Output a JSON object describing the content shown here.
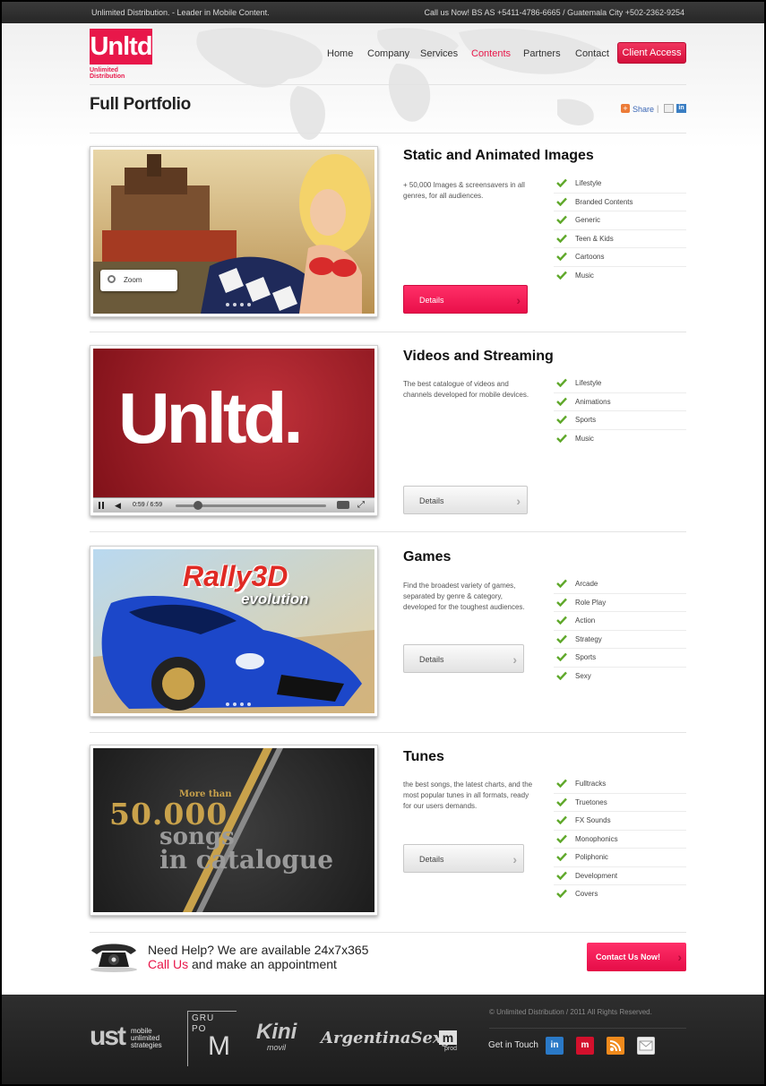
{
  "topbar": {
    "left_text": "Unlimited Distribution. - Leader in Mobile Content.",
    "right_text": "Call us Now! BS AS +5411-4786-6665 / Guatemala City +502-2362-9254"
  },
  "logo": {
    "mark": "Unltd",
    "line1": "Unlimited",
    "line2": "Distribution"
  },
  "nav": [
    {
      "label": "Home"
    },
    {
      "label": "Company"
    },
    {
      "label": "Services"
    },
    {
      "label": "Contents"
    },
    {
      "label": "Partners"
    },
    {
      "label": "Contact"
    }
  ],
  "nav_active_index": 3,
  "client_access": "Client Access",
  "page_title": "Full Portfolio",
  "share": {
    "icon": "share-plus-icon",
    "label": "Share",
    "separator": "|"
  },
  "sections": [
    {
      "title": "Static and Animated Images",
      "description": "+ 50,000 Images & screensavers in all genres, for all audiences.",
      "items": [
        "Lifestyle",
        "Branded Contents",
        "Generic",
        "Teen & Kids",
        "Cartoons",
        "Music"
      ],
      "button": "Details",
      "zoom_label": "Zoom"
    },
    {
      "title": "Videos and Streaming",
      "description": "The best catalogue of videos and channels developed for mobile devices.",
      "items": [
        "Lifestyle",
        "Animations",
        "Sports",
        "Music"
      ],
      "button": "Details",
      "video_brand": "Unltd.",
      "player_time": "0:59 / 6:59"
    },
    {
      "title": "Games",
      "description": "Find the broadest variety of games, separated by genre & category, developed for the toughest audiences.",
      "items": [
        "Arcade",
        "Role Play",
        "Action",
        "Strategy",
        "Sports",
        "Sexy"
      ],
      "button": "Details",
      "game_title": "Rally3D",
      "game_subtitle": "evolution"
    },
    {
      "title": "Tunes",
      "description": "the best songs, the latest charts, and the most popular tunes in all formats, ready for our users demands.",
      "items": [
        "Fulltracks",
        "Truetones",
        "FX Sounds",
        "Monophonics",
        "Poliphonic",
        "Development",
        "Covers"
      ],
      "button": "Details",
      "poster_line1": "More than",
      "poster_line2": "50.000",
      "poster_line3": "songs",
      "poster_line4": "in catalogue"
    }
  ],
  "help": {
    "title": "Need Help? We are available 24x7x365",
    "call_us": "Call Us",
    "rest": " and make an appointment",
    "button": "Contact Us Now!"
  },
  "footer": {
    "copyright": "© Unlimited Distribution  / 2011 All Rights Reserved.",
    "get_in_touch": "Get in Touch",
    "partners": {
      "ust": "ust",
      "ust_sub1": "mobile",
      "ust_sub2": "unlimited",
      "ust_sub3": "strategies",
      "grupo": "GRU",
      "grupo2": "PO",
      "grupo3": "M",
      "kini": "Kini",
      "kini_sub": "movil",
      "argentina": "ArgentinaSexy",
      "mprod": "m",
      "mprod_sub": "prod"
    },
    "social": [
      {
        "icon": "linkedin-icon",
        "label": "in",
        "color": "#2a79c7"
      },
      {
        "icon": "m-icon",
        "label": "m",
        "color": "#d3102c"
      },
      {
        "icon": "rss-icon",
        "label": "",
        "color": "#f08a1c"
      },
      {
        "icon": "mail-icon",
        "label": "",
        "color": "#eeeeee"
      }
    ]
  },
  "colors": {
    "accent": "#e8174a",
    "dark": "#262626"
  }
}
